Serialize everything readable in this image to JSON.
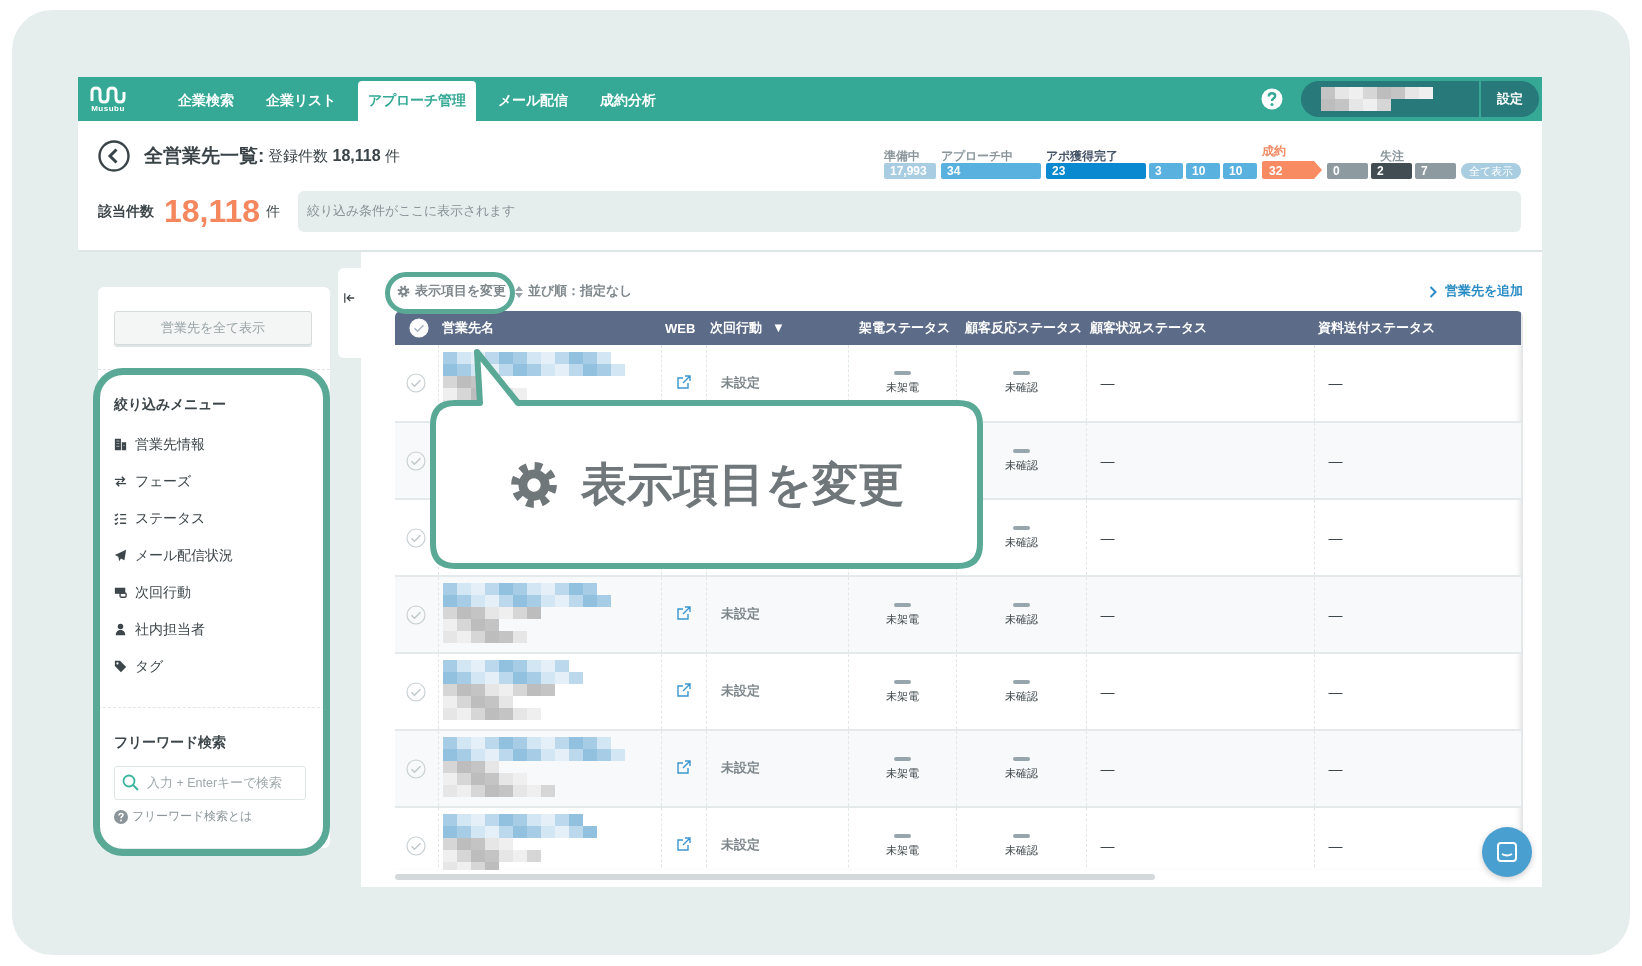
{
  "header": {
    "logo": "Musubu",
    "tabs": [
      {
        "label": "企業検索",
        "selected": false
      },
      {
        "label": "企業リスト",
        "selected": false
      },
      {
        "label": "アプローチ管理",
        "selected": true
      },
      {
        "label": "メール配信",
        "selected": false
      },
      {
        "label": "成約分析",
        "selected": false
      }
    ],
    "settings": "設定"
  },
  "title": {
    "text": "全営業先一覧:",
    "count": "登録件数 **18,118** 件"
  },
  "phases": [
    {
      "label": "準備中",
      "color": "#8a969c",
      "segments": [
        {
          "value": "17,993",
          "color": "#a8cde2",
          "kind": "medium"
        }
      ]
    },
    {
      "label": "アプローチ中",
      "color": "#8a969c",
      "segments": [
        {
          "value": "34",
          "color": "#58b1df",
          "kind": "long"
        }
      ]
    },
    {
      "label": "アポ獲得完了",
      "color": "#475569",
      "segments": [
        {
          "value": "23",
          "color": "#0a88d0",
          "kind": "long"
        },
        {
          "value": "3",
          "color": "#58b1df",
          "kind": "short"
        },
        {
          "value": "10",
          "color": "#58b1df",
          "kind": "short"
        },
        {
          "value": "10",
          "color": "#58b1df",
          "kind": "short"
        }
      ]
    },
    {
      "label": "成約",
      "color": "#f28a64",
      "segments": [
        {
          "value": "32",
          "color": "#f98b63",
          "kind": "arrow"
        }
      ]
    },
    {
      "label": "失注",
      "color": "#8a969c",
      "segments": [
        {
          "value": "0",
          "color": "#8d9aa0",
          "kind": "block"
        },
        {
          "value": "2",
          "color": "#414d53",
          "kind": "block"
        },
        {
          "value": "7",
          "color": "#8d9aa0",
          "kind": "block"
        }
      ]
    }
  ],
  "show_all": "全て表示",
  "result": {
    "label": "該当件数",
    "count": "18,118",
    "unit": "件",
    "filter_placeholder": "絞り込み条件がここに表示されます"
  },
  "sidebar": {
    "show_all_button": "営業先を全て表示",
    "filter_title": "絞り込みメニュー",
    "filter_items": [
      {
        "label": "営業先情報",
        "kind": "building"
      },
      {
        "label": "フェーズ",
        "kind": "arrows"
      },
      {
        "label": "ステータス",
        "kind": "checklist"
      },
      {
        "label": "メール配信状況",
        "kind": "plane"
      },
      {
        "label": "次回行動",
        "kind": "card"
      },
      {
        "label": "社内担当者",
        "kind": "person"
      },
      {
        "label": "タグ",
        "kind": "tag"
      }
    ],
    "search_title": "フリーワード検索",
    "search_placeholder": "入力 + Enterキーで検索",
    "search_help": "フリーワード検索とは"
  },
  "toolbar": {
    "columns_button": "表示項目を変更",
    "sort": "並び順：指定なし",
    "add_link": "営業先を追加"
  },
  "table": {
    "select_all": {
      "checked": false
    },
    "columns": [
      {
        "label": "営業先名"
      },
      {
        "label": "WEB"
      },
      {
        "label": "次回行動",
        "sort": "▼"
      },
      {
        "label": "架電ステータス"
      },
      {
        "label": "顧客反応ステータス"
      },
      {
        "label": "顧客状況ステータス"
      },
      {
        "label": "資料送付ステータス"
      }
    ],
    "rows": [
      {
        "selected": false,
        "web_link": true,
        "next_action": "未設定",
        "call_status": "未架電",
        "response_status": "未確認",
        "customer_status": "—",
        "document_status": "—"
      },
      {
        "selected": false,
        "response_status": "未確認",
        "customer_status": "—",
        "document_status": "—"
      },
      {
        "selected": false,
        "response_status": "未確認",
        "customer_status": "—",
        "document_status": "—"
      },
      {
        "selected": false,
        "web_link": true,
        "next_action": "未設定",
        "call_status": "未架電",
        "response_status": "未確認",
        "customer_status": "—",
        "document_status": "—"
      },
      {
        "selected": false,
        "web_link": true,
        "next_action": "未設定",
        "call_status": "未架電",
        "response_status": "未確認",
        "customer_status": "—",
        "document_status": "—"
      },
      {
        "selected": false,
        "web_link": true,
        "next_action": "未設定",
        "call_status": "未架電",
        "response_status": "未確認",
        "customer_status": "—",
        "document_status": "—"
      },
      {
        "selected": false,
        "web_link": true,
        "next_action": "未設定",
        "call_status": "未架電",
        "response_status": "未確認",
        "customer_status": "—",
        "document_status": "—"
      }
    ]
  },
  "callout": {
    "text": "表示項目を変更"
  }
}
